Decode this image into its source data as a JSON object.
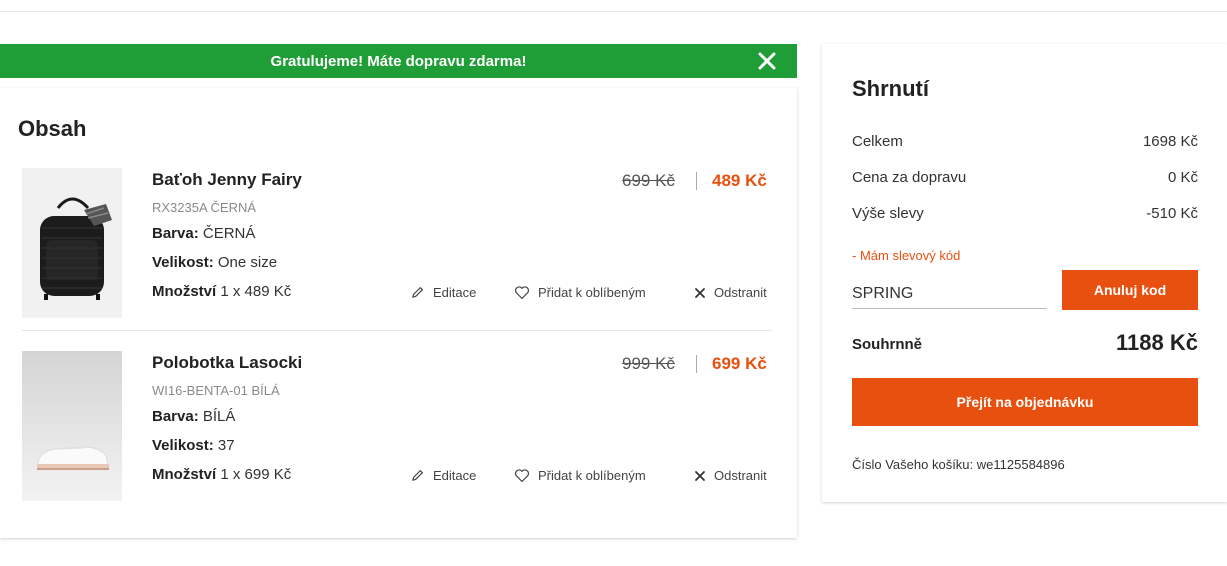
{
  "banner": {
    "message": "Gratulujeme! Máte dopravu zdarma!"
  },
  "cart": {
    "title": "Obsah",
    "labels": {
      "color": "Barva:",
      "size": "Velikost:",
      "quantity": "Množství"
    },
    "actions": {
      "edit": "Editace",
      "favorite": "Přidat k oblíbeným",
      "remove": "Odstranit"
    },
    "items": [
      {
        "name": "Baťoh Jenny Fairy",
        "code": "RX3235A ČERNÁ",
        "color": "ČERNÁ",
        "size": "One size",
        "quantity": "1 x 489 Kč",
        "old_price": "699 Kč",
        "new_price": "489 Kč"
      },
      {
        "name": "Polobotka Lasocki",
        "code": "WI16-BENTA-01 BÍLÁ",
        "color": "BÍLÁ",
        "size": "37",
        "quantity": "1 x 699 Kč",
        "old_price": "999 Kč",
        "new_price": "699 Kč"
      }
    ]
  },
  "summary": {
    "title": "Shrnutí",
    "total_label": "Celkem",
    "total_value": "1698 Kč",
    "shipping_label": "Cena za dopravu",
    "shipping_value": "0 Kč",
    "discount_label": "Výše slevy",
    "discount_value": "-510 Kč",
    "promo_toggle": "- Mám slevový kód",
    "promo_code": "SPRING",
    "promo_button": "Anuluj kod",
    "grand_label": "Souhrnně",
    "grand_value": "1188 Kč",
    "checkout_button": "Přejít na objednávku",
    "cart_id": "Číslo Vašeho košíku: we1125584896"
  },
  "colors": {
    "accent": "#e8500f",
    "success": "#1f9e37"
  }
}
